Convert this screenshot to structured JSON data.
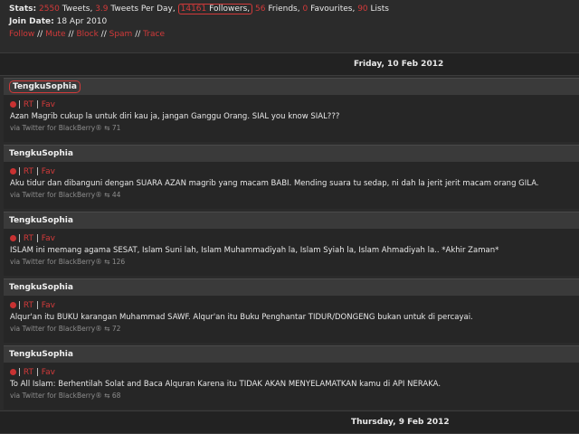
{
  "stats": {
    "label": "Stats:",
    "tweets_count": "2550",
    "tweets_label": "Tweets,",
    "per_day_count": "3.9",
    "per_day_label": "Tweets Per Day,",
    "followers_count": "14161",
    "followers_label": "Followers,",
    "friends_count": "56",
    "friends_label": "Friends,",
    "favourites_count": "0",
    "favourites_label": "Favourites,",
    "lists_count": "90",
    "lists_label": "Lists"
  },
  "join": {
    "label": "Join Date:",
    "value": "18 Apr 2010"
  },
  "actions": [
    "Follow",
    "Mute",
    "Block",
    "Spam",
    "Trace"
  ],
  "action_sep": "//",
  "dates": {
    "first": "Friday, 10 Feb 2012",
    "second": "Thursday, 9 Feb 2012"
  },
  "tweets": [
    {
      "user": "TengkuSophia",
      "rt": "RT",
      "fav": "Fav",
      "text": "Azan Magrib cukup la untuk diri kau ja, jangan Ganggu Orang. SIAL you know SIAL???",
      "via": "via Twitter for BlackBerry®",
      "retweets": "71"
    },
    {
      "user": "TengkuSophia",
      "rt": "RT",
      "fav": "Fav",
      "text": "Aku tidur dan dibanguni dengan SUARA AZAN magrib yang macam BABI. Mending suara tu sedap, ni dah la jerit jerit macam orang GILA.",
      "via": "via Twitter for BlackBerry®",
      "retweets": "44"
    },
    {
      "user": "TengkuSophia",
      "rt": "RT",
      "fav": "Fav",
      "text": "ISLAM ini memang agama SESAT, Islam Suni lah, Islam Muhammadiyah la, Islam Syiah la, Islam Ahmadiyah la.. *Akhir Zaman*",
      "via": "via Twitter for BlackBerry®",
      "retweets": "126"
    },
    {
      "user": "TengkuSophia",
      "rt": "RT",
      "fav": "Fav",
      "text": "Alqur'an itu BUKU karangan Muhammad SAWF. Alqur'an itu Buku Penghantar TIDUR/DONGENG bukan untuk di percayai.",
      "via": "via Twitter for BlackBerry®",
      "retweets": "72"
    },
    {
      "user": "TengkuSophia",
      "rt": "RT",
      "fav": "Fav",
      "text": "To All Islam: Berhentilah Solat and Baca Alquran Karena itu TIDAK AKAN MENYELAMATKAN kamu di API NERAKA.",
      "via": "via Twitter for BlackBerry®",
      "retweets": "68"
    }
  ],
  "retweet_icon": "retweet-icon",
  "colors": {
    "accent": "#d23a3a",
    "background": "#2b2b2b",
    "header_bar": "#3a3a3a"
  }
}
